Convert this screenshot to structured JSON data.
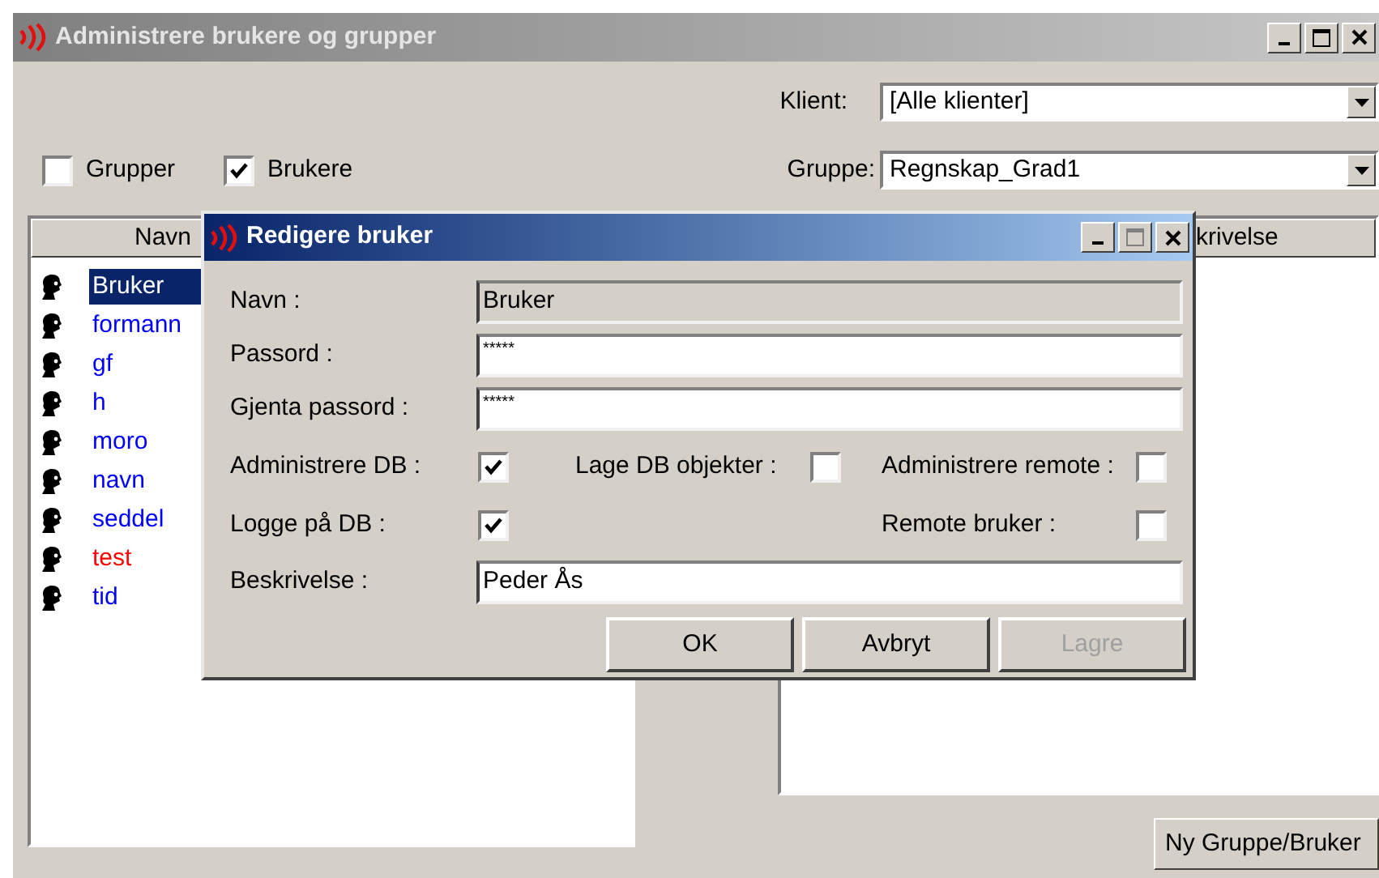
{
  "window": {
    "title": "Administrere brukere og grupper"
  },
  "filters": {
    "klient_label": "Klient:",
    "klient_value": "[Alle klienter]",
    "gruppe_label": "Gruppe:",
    "gruppe_value": "Regnskap_Grad1"
  },
  "view_toggles": [
    {
      "label": "Grupper",
      "checked": false
    },
    {
      "label": "Brukere",
      "checked": true
    }
  ],
  "user_list": {
    "header": "Navn",
    "items": [
      {
        "name": "Bruker",
        "selected": true
      },
      {
        "name": "formann",
        "selected": false,
        "color": "#0000ff"
      },
      {
        "name": "gf",
        "selected": false,
        "color": "#0000ff"
      },
      {
        "name": "h",
        "selected": false,
        "color": "#0000ff"
      },
      {
        "name": "moro",
        "selected": false,
        "color": "#0000ff"
      },
      {
        "name": "navn",
        "selected": false,
        "color": "#0000ff"
      },
      {
        "name": "seddel",
        "selected": false,
        "color": "#0000ff"
      },
      {
        "name": "test",
        "selected": false,
        "color": "#ff0000"
      },
      {
        "name": "tid",
        "selected": false,
        "color": "#0000ff"
      }
    ]
  },
  "detail_list": {
    "header": "krivelse"
  },
  "new_button": "Ny Gruppe/Bruker",
  "dialog": {
    "title": "Redigere bruker",
    "fields": [
      {
        "label": "Navn :",
        "value": "Bruker",
        "disabled": true
      },
      {
        "label": "Passord :",
        "value": "*****",
        "disabled": false
      },
      {
        "label": "Gjenta passord :",
        "value": "*****",
        "disabled": false
      }
    ],
    "permission_rows": [
      [
        {
          "label": "Administrere DB :",
          "checked": true
        },
        {
          "label": "Lage DB objekter :",
          "checked": false
        },
        {
          "label": "Administrere remote :",
          "checked": false
        }
      ],
      [
        {
          "label": "Logge på DB :",
          "checked": true
        },
        null,
        {
          "label": "Remote bruker :",
          "checked": false
        }
      ]
    ],
    "description": {
      "label": "Beskrivelse :",
      "value": "Peder Ås"
    },
    "buttons": [
      {
        "label": "OK",
        "disabled": false
      },
      {
        "label": "Avbryt",
        "disabled": false
      },
      {
        "label": "Lagre",
        "disabled": true
      }
    ]
  }
}
